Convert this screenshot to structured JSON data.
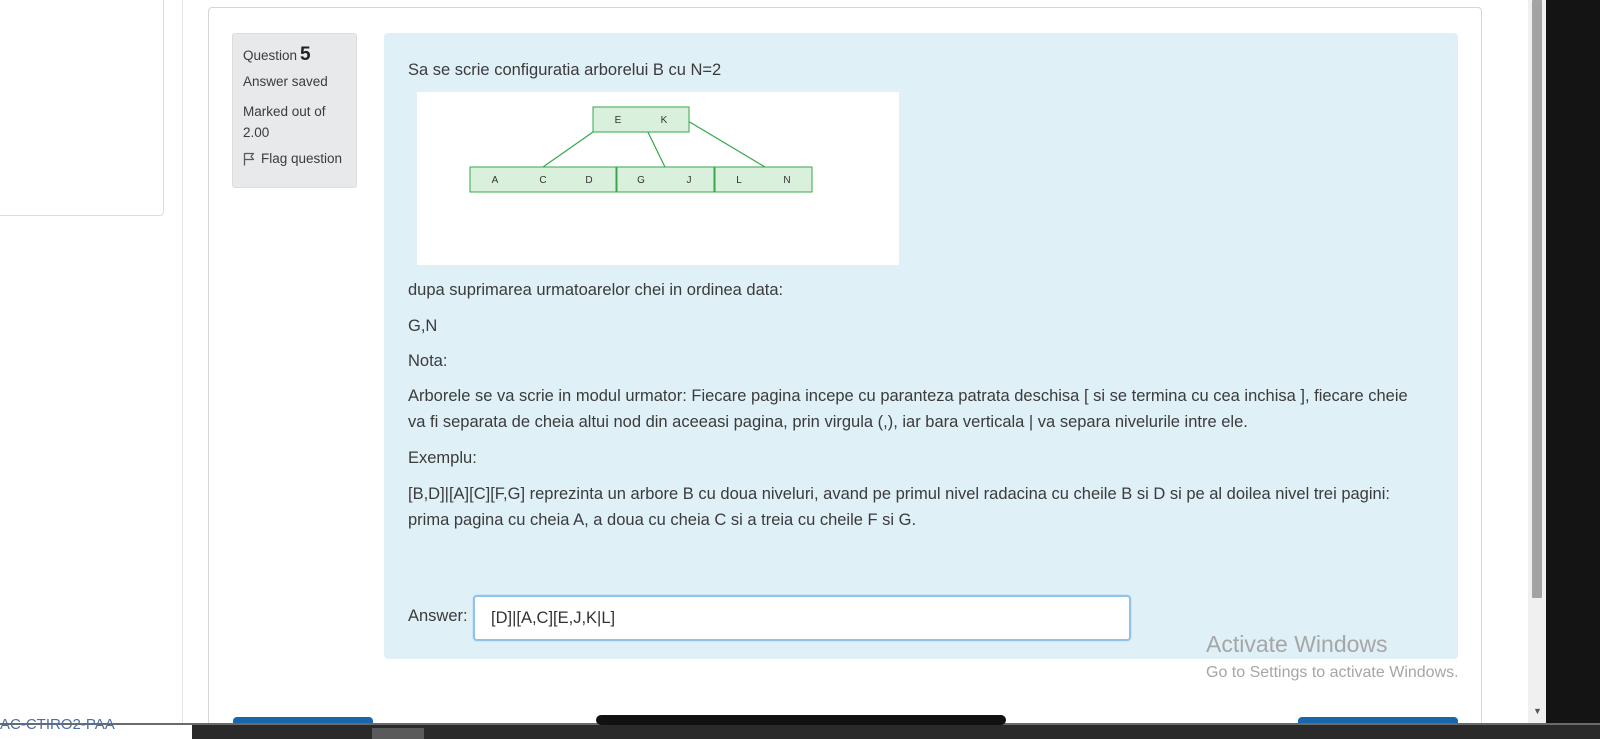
{
  "question": {
    "label": "Question",
    "number": "5",
    "state": "Answer saved",
    "marks": "Marked out of 2.00",
    "flag_label": "Flag question"
  },
  "content": {
    "prompt": "Sa se scrie configuratia arborelui B cu N=2",
    "tree": {
      "root_keys": [
        "E",
        "K"
      ],
      "leaves": [
        {
          "keys": [
            "A",
            "C",
            "D"
          ]
        },
        {
          "keys": [
            "G",
            "J"
          ]
        },
        {
          "keys": [
            "L",
            "N"
          ]
        }
      ],
      "stroke_color": "#36a74a",
      "fill_color": "#d9f0dc"
    },
    "after_text": "dupa suprimarea urmatoarelor chei in ordinea data:",
    "keys_text": "G,N",
    "note_label": "Nota:",
    "note_text": "Arborele se va scrie in modul urmator: Fiecare pagina incepe cu paranteza patrata deschisa [ si se termina cu cea inchisa ], fiecare cheie va fi separata de cheia altui nod din aceeasi pagina, prin virgula (,), iar bara verticala | va separa nivelurile intre ele.",
    "example_label": "Exemplu:",
    "example_text": "[B,D]|[A][C][F,G] reprezinta un arbore B cu doua niveluri, avand pe primul nivel radacina cu cheile B si D si pe al doilea nivel trei pagini: prima pagina cu cheia A, a doua cu cheia C si a treia cu cheile F si G."
  },
  "answer": {
    "label": "Answer:",
    "value": "[D]|[A,C][E,J,K|L]"
  },
  "watermark": {
    "title": "Activate Windows",
    "subtitle": "Go to Settings to activate Windows."
  },
  "course_code": "AC-CTIRO2-PAA",
  "colors": {
    "panel_bg": "#dff0f7",
    "info_bg": "#e7e9ea",
    "primary_button": "#1a66ad",
    "input_focus_border": "#8fc3ea"
  }
}
